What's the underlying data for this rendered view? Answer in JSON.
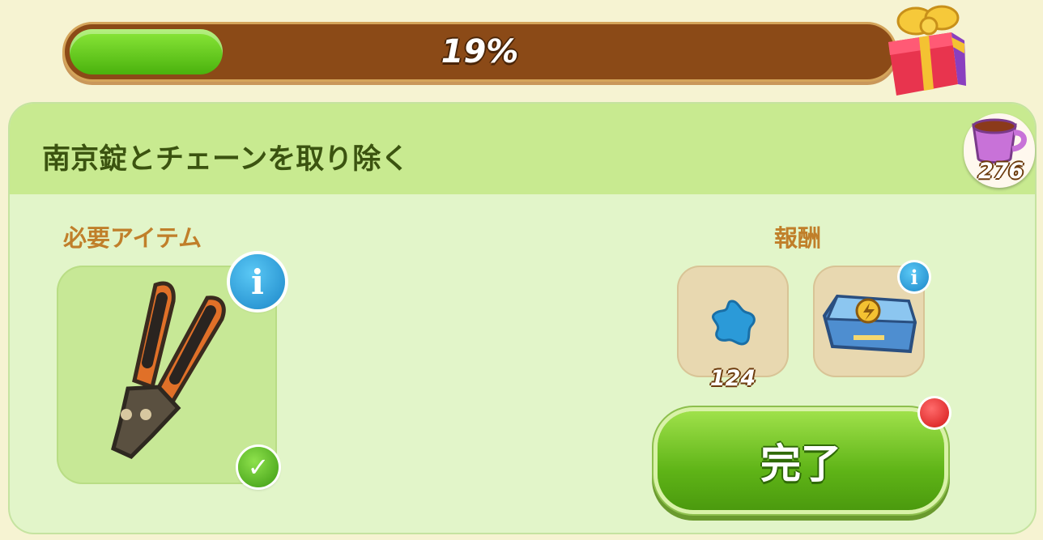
{
  "progress": {
    "value": 0.19,
    "label": "19%",
    "reward_icon": "gift-box-icon"
  },
  "currency": {
    "icon": "teacup-icon",
    "count": "276"
  },
  "quest": {
    "title": "南京錠とチェーンを取り除く",
    "required_label": "必要アイテム",
    "required_item": {
      "icon": "bolt-cutter-icon",
      "info_icon": "info-icon",
      "status_icon": "checkmark-icon",
      "collected": true
    },
    "reward_label": "報酬",
    "rewards": [
      {
        "icon": "blue-star-icon",
        "count": "124"
      },
      {
        "icon": "lightning-chest-icon",
        "info_icon": "info-icon"
      }
    ],
    "complete_button": "完了",
    "notification": true
  },
  "colors": {
    "accent_green": "#5fb417",
    "progress_track": "#8b4a17",
    "label_orange": "#c07f2a",
    "title_green": "#3b5310"
  }
}
